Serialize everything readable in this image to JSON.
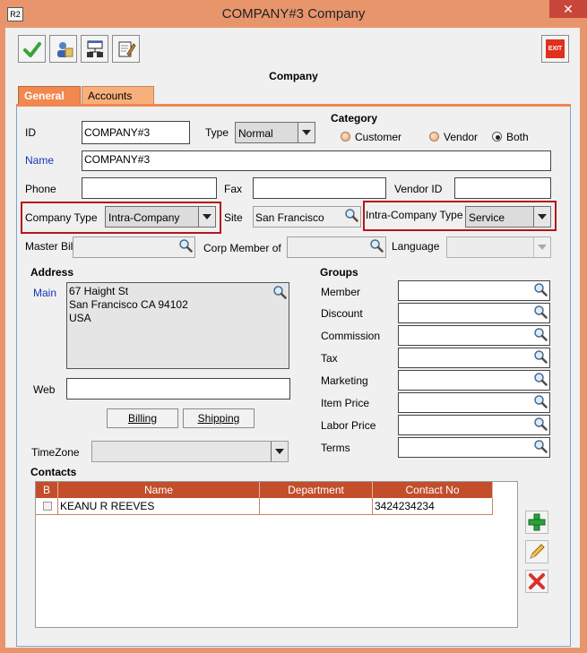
{
  "window": {
    "title": "COMPANY#3 Company",
    "app_icon": "R2",
    "close_label": "✕"
  },
  "toolbar": {
    "save_icon": "check-icon",
    "contact_icon": "contact-icon",
    "network_icon": "network-icon",
    "edit_icon": "notes-icon",
    "exit_label": "EXIT"
  },
  "heading": "Company",
  "tabs": [
    {
      "label": "General",
      "active": true
    },
    {
      "label": "Accounts",
      "active": false
    }
  ],
  "form": {
    "id_label": "ID",
    "id_value": "COMPANY#3",
    "type_label": "Type",
    "type_value": "Normal",
    "category_label": "Category",
    "category_options": [
      "Customer",
      "Vendor",
      "Both"
    ],
    "category_selected": "Both",
    "name_label": "Name",
    "name_value": "COMPANY#3",
    "phone_label": "Phone",
    "phone_value": "",
    "fax_label": "Fax",
    "fax_value": "",
    "vendor_id_label": "Vendor ID",
    "vendor_id_value": "",
    "company_type_label": "Company Type",
    "company_type_value": "Intra-Company",
    "site_label": "Site",
    "site_value": "San Francisco",
    "intra_company_type_label": "Intra-Company Type",
    "intra_company_type_value": "Service",
    "master_billing_label": "Master Billing",
    "master_billing_value": "",
    "corp_member_label": "Corp Member of",
    "corp_member_value": "",
    "language_label": "Language",
    "language_value": ""
  },
  "address": {
    "section_label": "Address",
    "main_label": "Main",
    "lines": [
      "67 Haight St",
      "San Francisco CA 94102",
      "USA"
    ],
    "web_label": "Web",
    "web_value": "",
    "billing_label": "Billing",
    "shipping_label": "Shipping",
    "timezone_label": "TimeZone",
    "timezone_value": ""
  },
  "groups": {
    "section_label": "Groups",
    "items": [
      {
        "label": "Member",
        "value": ""
      },
      {
        "label": "Discount",
        "value": ""
      },
      {
        "label": "Commission",
        "value": ""
      },
      {
        "label": "Tax",
        "value": ""
      },
      {
        "label": "Marketing",
        "value": ""
      },
      {
        "label": "Item Price",
        "value": ""
      },
      {
        "label": "Labor Price",
        "value": ""
      },
      {
        "label": "Terms",
        "value": ""
      }
    ]
  },
  "contacts": {
    "section_label": "Contacts",
    "columns": [
      "B",
      "Name",
      "Department",
      "Contact No"
    ],
    "rows": [
      {
        "b": "",
        "name": "KEANU R REEVES",
        "department": "",
        "contact_no": "3424234234"
      }
    ],
    "add_icon": "plus-icon",
    "edit_icon": "pencil-icon",
    "delete_icon": "delete-icon"
  },
  "colors": {
    "window_frame": "#e8956c",
    "tab_active": "#f08850",
    "tab_inactive": "#f7b07c",
    "table_header": "#c24e2b",
    "highlight_border": "#b2161b",
    "link_label": "#1a33b8"
  }
}
